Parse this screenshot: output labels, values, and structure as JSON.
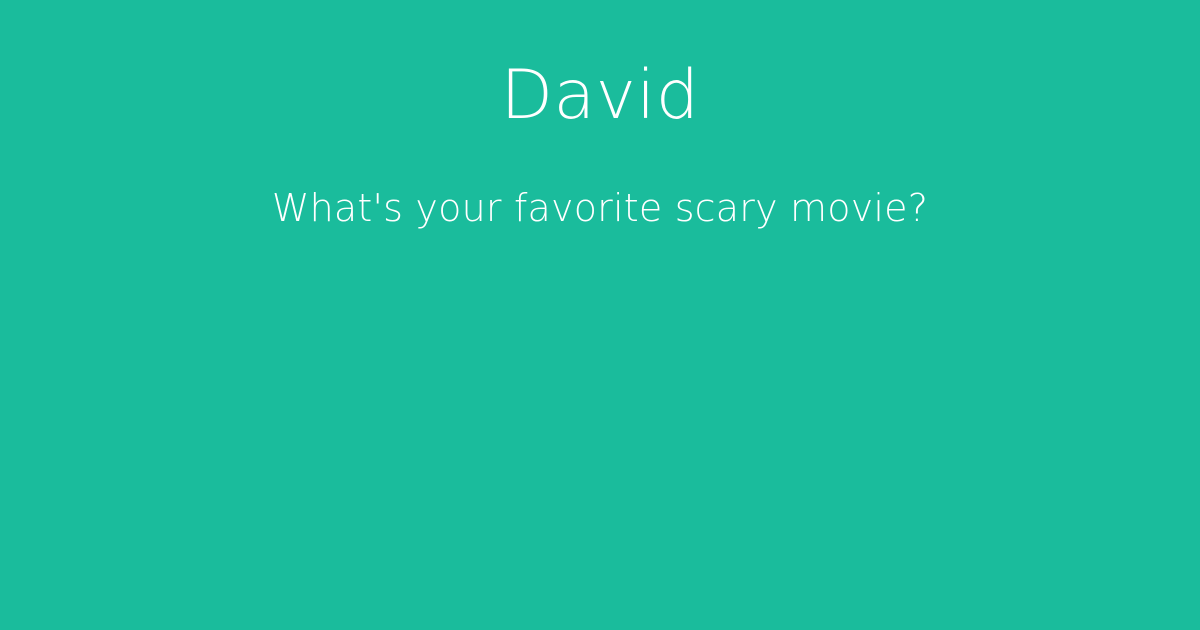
{
  "card": {
    "name": "David",
    "question": "What's your favorite scary movie?",
    "background_color": "#1abc9c",
    "text_color": "#ffffff"
  }
}
